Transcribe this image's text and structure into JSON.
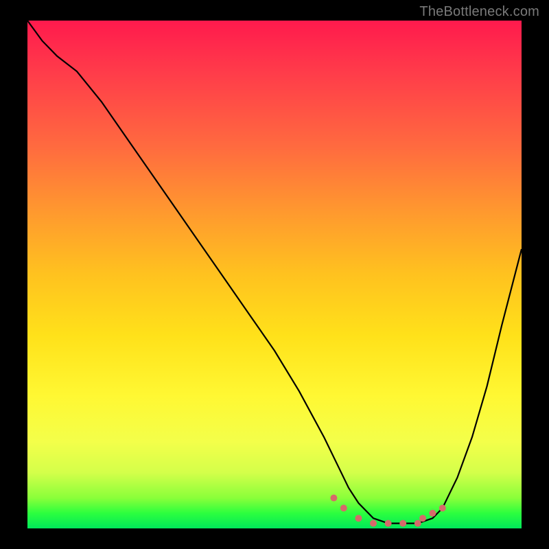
{
  "watermark": "TheBottleneck.com",
  "chart_data": {
    "type": "line",
    "title": "",
    "xlabel": "",
    "ylabel": "",
    "xlim": [
      0,
      100
    ],
    "ylim": [
      0,
      100
    ],
    "series": [
      {
        "name": "curve",
        "x": [
          0,
          3,
          6,
          10,
          15,
          20,
          25,
          30,
          35,
          40,
          45,
          50,
          55,
          60,
          63,
          65,
          67,
          70,
          73,
          76,
          79,
          82,
          84,
          87,
          90,
          93,
          96,
          100
        ],
        "values": [
          100,
          96,
          93,
          90,
          84,
          77,
          70,
          63,
          56,
          49,
          42,
          35,
          27,
          18,
          12,
          8,
          5,
          2,
          1,
          1,
          1,
          2,
          4,
          10,
          18,
          28,
          40,
          55
        ]
      }
    ],
    "dots": {
      "name": "floor-markers",
      "x": [
        62,
        64,
        67,
        70,
        73,
        76,
        79,
        80,
        82,
        84
      ],
      "values": [
        6,
        4,
        2,
        1,
        1,
        1,
        1,
        2,
        3,
        4
      ]
    },
    "gradient_colors": {
      "top": "#ff1a4d",
      "upper_mid": "#ff9a2e",
      "mid": "#ffe11a",
      "lower_mid": "#d4ff4a",
      "bottom": "#00e85a"
    }
  }
}
